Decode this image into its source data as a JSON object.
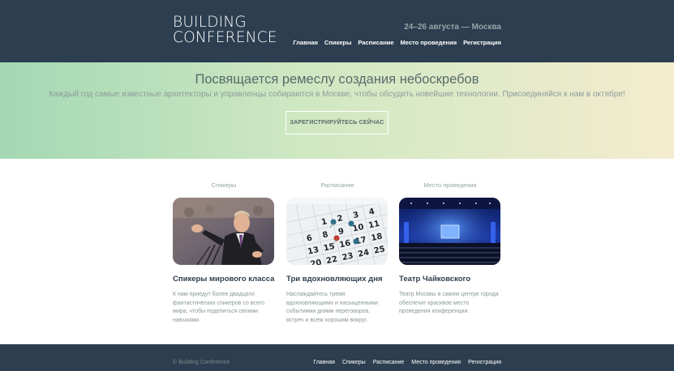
{
  "header": {
    "logo_line1": "BUILDING",
    "logo_line2": "CONFERENCE",
    "dates": "24–26 августа — Москва",
    "nav": [
      "Главная",
      "Спикеры",
      "Расписание",
      "Место проведения",
      "Регистрация"
    ]
  },
  "hero": {
    "title": "Посвящается ремеслу создания небоскребов",
    "subtitle": "Каждый год самые известные архитекторы и управленцы собираются в Москве, чтобы обсудить новейшие технологии. Присоединяйся к нам в октябре!",
    "button_label": "ЗАРЕГИСТРИРУЙТЕСЬ СЕЙЧАС"
  },
  "features": [
    {
      "caption": "Спикеры",
      "title": "Спикеры мирового класса",
      "description": "К нам приедут более двадцати фантастических спикеров со всего мира, чтобы поделиться своими навыками.",
      "image": "speaker-photo"
    },
    {
      "caption": "Расписание",
      "title": "Три вдохновляющих дня",
      "description": "Наслаждайтесь тремя вдохновляющими и насыщенными событиями днями переговоров, встреч и всем хорошим вокруг.",
      "image": "calendar-photo"
    },
    {
      "caption": "Место проведения",
      "title": "Театр Чайковского",
      "description": "Театр Москвы в самом центре города обеспечит красивое место проведения конференции.",
      "image": "venue-photo"
    }
  ],
  "footer": {
    "copyright": "© Building Conference",
    "nav": [
      "Главная",
      "Спикеры",
      "Расписание",
      "Место проведения",
      "Регистрация"
    ]
  }
}
